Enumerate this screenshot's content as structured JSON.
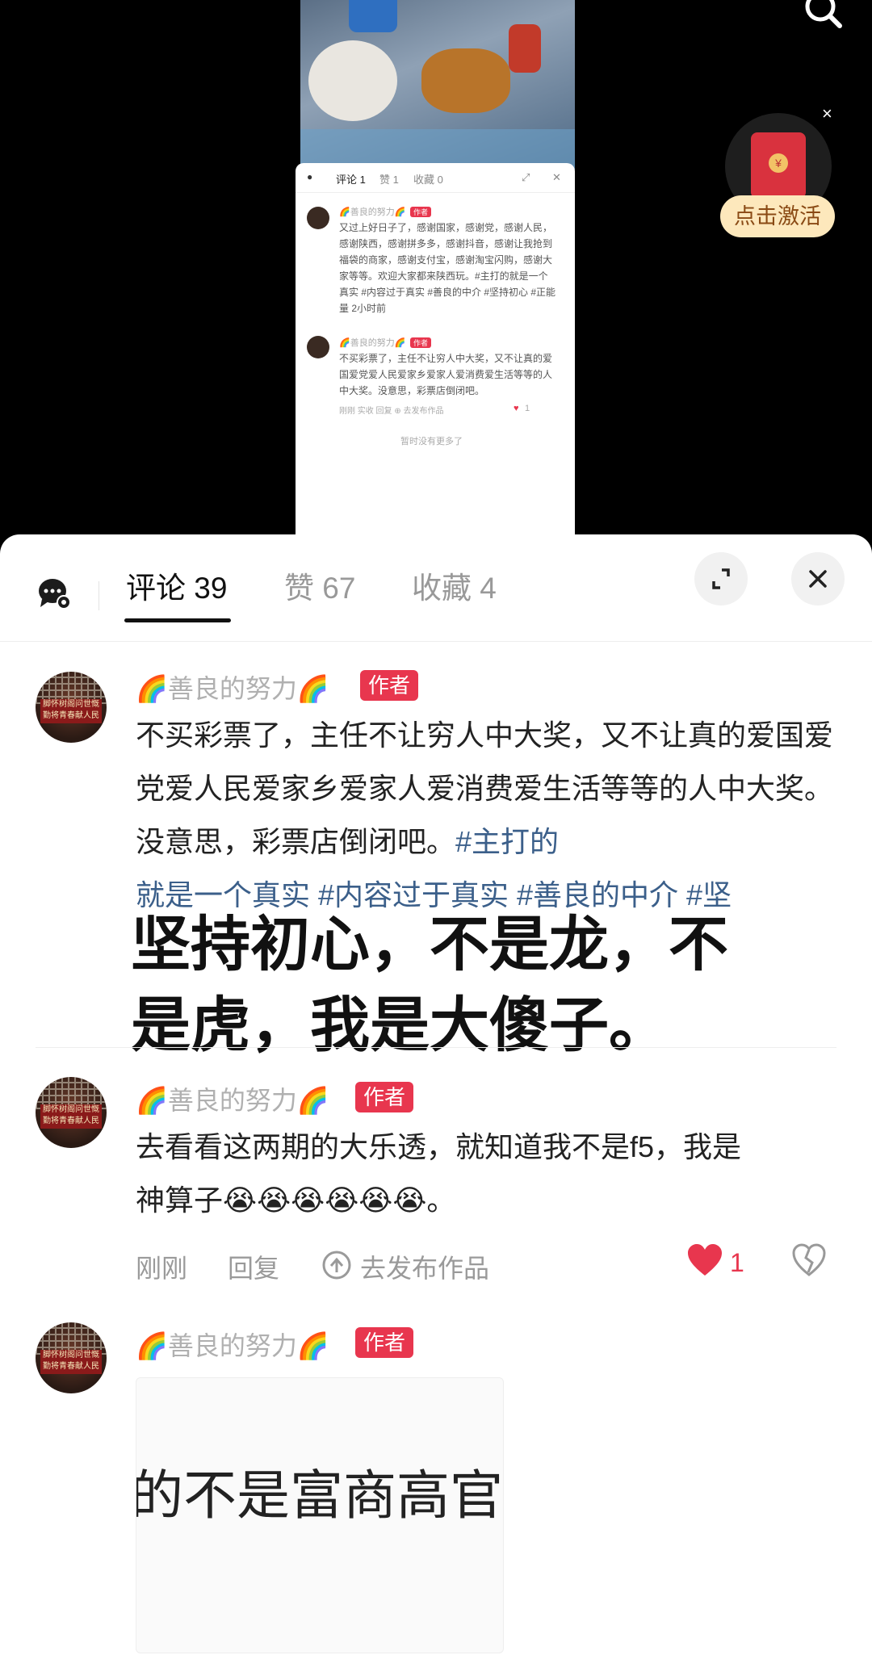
{
  "mini_panel": {
    "tabs": [
      "评论 1",
      "赞 1",
      "收藏 0"
    ],
    "comment1_name": "🌈善良的努力🌈",
    "comment1_tag": "作者",
    "comment1_text": "又过上好日子了，感谢国家，感谢党，感谢人民，感谢陕西，感谢拼多多，感谢抖音，感谢让我抢到福袋的商家，感谢支付宝，感谢淘宝闪购，感谢大家等等。欢迎大家都来陕西玩。#主打的就是一个真实 #内容过于真实 #善良的中介 #坚持初心 #正能量 2小时前",
    "comment2_name": "🌈善良的努力🌈",
    "comment2_tag": "作者",
    "comment2_text": "不买彩票了，主任不让穷人中大奖，又不让真的爱国爱党爱人民爱家乡爱家人爱消费爱生活等等的人中大奖。没意思，彩票店倒闭吧。",
    "comment2_meta": "刚刚   实收   回复   ⊕ 去发布作品",
    "comment2_likes": "1",
    "footer": "暂时没有更多了"
  },
  "promo": {
    "close": "×",
    "activate_label": "点击激活",
    "envelope_seal": "¥"
  },
  "sheet": {
    "tabs": {
      "comments": "评论 39",
      "likes": "赞 67",
      "favorites": "收藏 4"
    }
  },
  "comments": [
    {
      "name": "🌈善良的努力🌈",
      "tag": "作者",
      "text": "不买彩票了，主任不让穷人中大奖，又不让真的爱国爱党爱人民爱家乡爱家人爱消费爱生活等等的人中大奖。没意思，彩票店倒闭吧。",
      "hashtags_line1": "#主打的",
      "hashtags_line2": "就是一个真实 #内容过于真实 #善良的中介 #坚"
    },
    {
      "name": "🌈善良的努力🌈",
      "tag": "作者",
      "text_line1": "去看看这两期的大乐透，就知道我不是f5，我是",
      "text_line2": "神算子😭😭😭😭😭😭。",
      "time": "刚刚",
      "reply": "回复",
      "publish": "去发布作品",
      "likes": "1"
    },
    {
      "name": "🌈善良的努力🌈",
      "tag": "作者",
      "image_text": "的不是富商高官"
    }
  ],
  "overlay": {
    "line1": "坚持初心，不是龙，不",
    "line2": "是虎，我是大傻子。"
  },
  "avatar_banner": "脚怀树阁问世慨 勤将青春献人民",
  "colors": {
    "accent_red": "#e8364e",
    "hashtag_blue": "#3b5f8a",
    "like_red": "#e8364e"
  }
}
